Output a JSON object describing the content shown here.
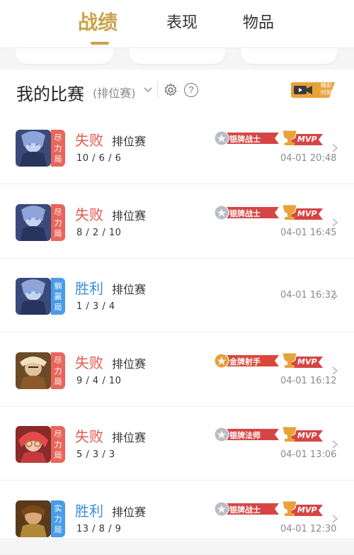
{
  "tabs": [
    {
      "label": "战绩",
      "active": true
    },
    {
      "label": "表现",
      "active": false
    },
    {
      "label": "物品",
      "active": false
    }
  ],
  "section": {
    "title": "我的比赛",
    "mode_filter": "(排位赛)",
    "highlight_label_1": "精彩",
    "highlight_label_2": "时刻"
  },
  "colors": {
    "accent": "#c9a24b",
    "lose": "#e3594e",
    "win": "#3a8fdc"
  },
  "matches": [
    {
      "tag": [
        "尽",
        "力",
        "局"
      ],
      "tag_color": "red",
      "result": "失败",
      "mode": "排位赛",
      "kda": "10 / 6 / 6",
      "badge": "银牌战士",
      "badge_tier": "silver",
      "mvp": "MVP",
      "time": "04-01 20:48",
      "hero": "hero-a"
    },
    {
      "tag": [
        "尽",
        "力",
        "局"
      ],
      "tag_color": "red",
      "result": "失败",
      "mode": "排位赛",
      "kda": "8 / 2 / 10",
      "badge": "银牌战士",
      "badge_tier": "silver",
      "mvp": "MVP",
      "time": "04-01 16:45",
      "hero": "hero-a"
    },
    {
      "tag": [
        "躺",
        "赢",
        "局"
      ],
      "tag_color": "blue",
      "result": "胜利",
      "mode": "排位赛",
      "kda": "1 / 3 / 4",
      "badge": "",
      "badge_tier": "",
      "mvp": "",
      "time": "04-01 16:32",
      "hero": "hero-a"
    },
    {
      "tag": [
        "尽",
        "力",
        "局"
      ],
      "tag_color": "red",
      "result": "失败",
      "mode": "排位赛",
      "kda": "9 / 4 / 10",
      "badge": "金牌射手",
      "badge_tier": "gold",
      "mvp": "MVP",
      "time": "04-01 16:12",
      "hero": "hero-b"
    },
    {
      "tag": [
        "尽",
        "力",
        "局"
      ],
      "tag_color": "red",
      "result": "失败",
      "mode": "排位赛",
      "kda": "5 / 3 / 3",
      "badge": "银牌法师",
      "badge_tier": "silver",
      "mvp": "MVP",
      "time": "04-01 13:06",
      "hero": "hero-c"
    },
    {
      "tag": [
        "实",
        "力",
        "局"
      ],
      "tag_color": "blue",
      "result": "胜利",
      "mode": "排位赛",
      "kda": "13 / 8 / 9",
      "badge": "银牌战士",
      "badge_tier": "silver",
      "mvp": "MVP",
      "time": "04-01 12:30",
      "hero": "hero-d"
    }
  ]
}
